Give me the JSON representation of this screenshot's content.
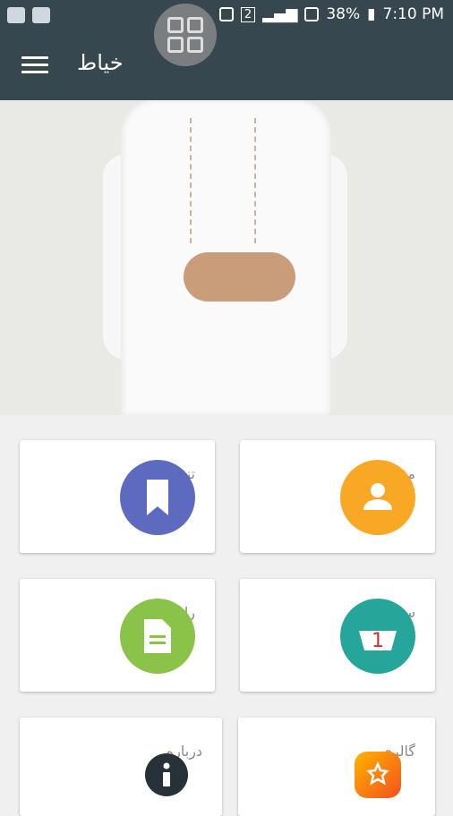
{
  "status": {
    "battery": "38%",
    "time": "7:10 PM",
    "sim": "2"
  },
  "app": {
    "title": "خياط"
  },
  "tiles": [
    {
      "label": "مشتریان",
      "icon": "person-icon",
      "color": "#f9a825"
    },
    {
      "label": "تنظیمات",
      "icon": "bookmark-icon",
      "color": "#5c6bc0"
    },
    {
      "label": "سفارشات",
      "icon": "basket-icon",
      "color": "#26a69a"
    },
    {
      "label": "راپور ها",
      "icon": "document-icon",
      "color": "#8bc34a"
    },
    {
      "label": "گالری",
      "icon": "gallery-icon",
      "color": "#ff9800"
    },
    {
      "label": "درباره",
      "icon": "info-icon",
      "color": "#263238"
    }
  ],
  "colors": {
    "appbar": "#37474f",
    "background": "#f0f0f0"
  }
}
